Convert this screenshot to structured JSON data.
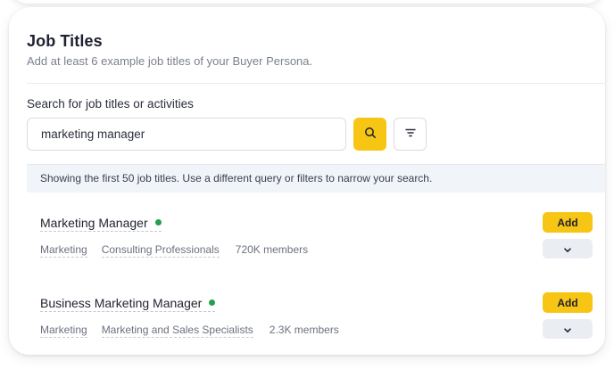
{
  "header": {
    "title": "Job Titles",
    "subtitle": "Add at least 6 example job titles of your Buyer Persona."
  },
  "search": {
    "label": "Search for job titles or activities",
    "value": "marketing manager",
    "search_icon": "search-icon",
    "filter_icon": "filter-icon"
  },
  "notice": "Showing the first 50 job titles. Use a different query or filters to narrow your search.",
  "results": [
    {
      "title": "Marketing Manager",
      "status_color": "#22a04f",
      "function": "Marketing",
      "industry": "Consulting Professionals",
      "members": "720K members",
      "add_label": "Add"
    },
    {
      "title": "Business Marketing Manager",
      "status_color": "#22a04f",
      "function": "Marketing",
      "industry": "Marketing and Sales Specialists",
      "members": "2.3K members",
      "add_label": "Add"
    }
  ],
  "colors": {
    "accent": "#f7c514",
    "status_active": "#22a04f"
  }
}
